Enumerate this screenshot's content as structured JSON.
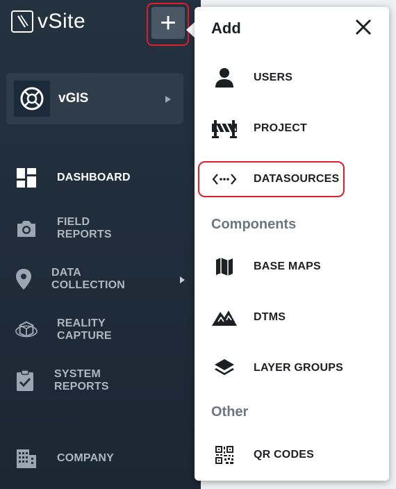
{
  "app": {
    "name": "vSite"
  },
  "header": {
    "add_button_symbol": "+"
  },
  "org": {
    "name": "vGIS"
  },
  "sidebar": {
    "items": [
      {
        "label": "DASHBOARD"
      },
      {
        "label": "FIELD REPORTS"
      },
      {
        "label": "DATA COLLECTION"
      },
      {
        "label": "REALITY CAPTURE"
      },
      {
        "label": "SYSTEM REPORTS"
      },
      {
        "label": "COMPANY"
      }
    ]
  },
  "add_menu": {
    "title": "Add",
    "items": [
      {
        "label": "USERS",
        "icon": "user-icon"
      },
      {
        "label": "PROJECT",
        "icon": "barrier-icon"
      },
      {
        "label": "DATASOURCES",
        "icon": "datasource-icon"
      }
    ],
    "sections": [
      {
        "label": "Components",
        "items": [
          {
            "label": "BASE MAPS",
            "icon": "map-icon"
          },
          {
            "label": "DTMS",
            "icon": "terrain-icon"
          },
          {
            "label": "LAYER GROUPS",
            "icon": "layers-icon"
          }
        ]
      },
      {
        "label": "Other",
        "items": [
          {
            "label": "QR CODES",
            "icon": "qr-code-icon"
          }
        ]
      }
    ]
  },
  "colors": {
    "sidebar": "#243240",
    "highlight": "#e21b2b",
    "text_dark": "#1d1f22"
  }
}
